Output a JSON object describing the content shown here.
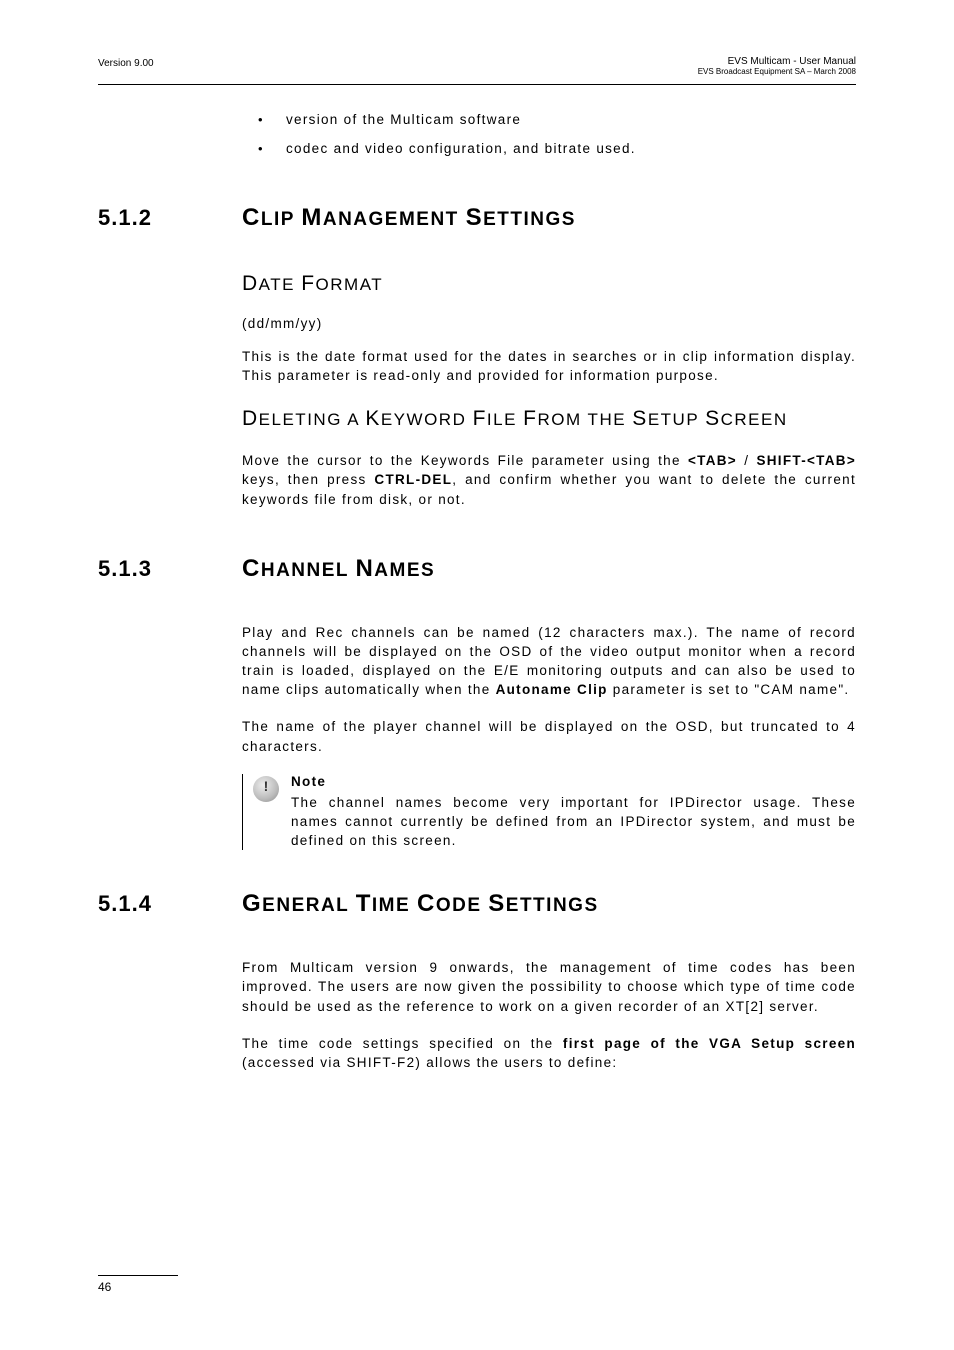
{
  "header": {
    "left": "Version 9.00",
    "right_line1": "EVS Multicam - User Manual",
    "right_line2": "EVS Broadcast Equipment SA – March 2008"
  },
  "bullets": [
    "version of the Multicam software",
    "codec and video configuration, and bitrate used."
  ],
  "sec_512": {
    "num": "5.1.2",
    "title_parts": [
      "C",
      "LIP ",
      "M",
      "ANAGEMENT ",
      "S",
      "ETTINGS"
    ],
    "h3a_parts": [
      "D",
      "ATE ",
      "F",
      "ORMAT"
    ],
    "date_fmt": "(dd/mm/yy)",
    "date_para": "This is the date format used for the dates in searches or in clip information display. This parameter is read-only and provided for information purpose.",
    "h3b_parts": [
      "D",
      "ELETING A ",
      "K",
      "EYWORD ",
      "F",
      "ILE ",
      "F",
      "ROM THE ",
      "S",
      "ETUP ",
      "S",
      "CREEN"
    ],
    "del_pre": "Move the cursor to the Keywords File parameter using the ",
    "del_b1": "<TAB>",
    "del_mid1": " / ",
    "del_b2": "SHIFT-<TAB>",
    "del_mid2": " keys, then press ",
    "del_b3": "CTRL-DEL",
    "del_post": ", and confirm whether you want to delete the current keywords file from disk, or not."
  },
  "sec_513": {
    "num": "5.1.3",
    "title_parts": [
      "C",
      "HANNEL ",
      "N",
      "AMES"
    ],
    "p1_pre": "Play and Rec channels can be named (12 characters max.). The name of record channels will be displayed on the OSD of the video output monitor when a record train is loaded, displayed on the E/E monitoring outputs and can also be used to name clips automatically when the ",
    "p1_b": "Autoname Clip",
    "p1_post": " parameter is set to \"CAM name\".",
    "p2": "The name of the player channel will be displayed on the OSD, but truncated to 4 characters.",
    "note_title": "Note",
    "note_body": "The channel names become very important for IPDirector usage. These names cannot currently be defined from an IPDirector system, and must be defined on this screen."
  },
  "sec_514": {
    "num": "5.1.4",
    "title_parts": [
      "G",
      "ENERAL ",
      "T",
      "IME ",
      "C",
      "ODE ",
      "S",
      "ETTINGS"
    ],
    "p1": "From Multicam version 9 onwards, the management of time codes has been improved. The users are now given the possibility to choose which type of time code should be used as the reference to work on a given recorder of an XT[2] server.",
    "p2_pre": "The time code settings specified on the ",
    "p2_b": "first page of the VGA Setup screen",
    "p2_post": " (accessed via SHIFT-F2) allows the users to define:"
  },
  "footer": {
    "page": "46"
  }
}
